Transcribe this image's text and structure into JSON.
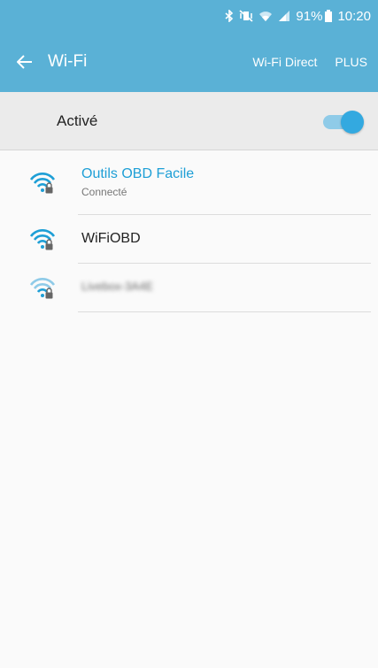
{
  "status_bar": {
    "battery": "91%",
    "time": "10:20",
    "icons": [
      "bluetooth-icon",
      "mute-vibrate-icon",
      "wifi-signal-icon",
      "cell-signal-icon",
      "battery-icon"
    ]
  },
  "header": {
    "title": "Wi-Fi",
    "back_icon": "arrow-left-icon",
    "actions": {
      "wifi_direct": "Wi-Fi Direct",
      "more": "PLUS"
    }
  },
  "toggle": {
    "label": "Activé",
    "on": true
  },
  "networks": [
    {
      "name": "Outils OBD Facile",
      "status": "Connecté",
      "connected": true,
      "secured": true,
      "icon": "wifi-lock-icon"
    },
    {
      "name": "WiFiOBD",
      "status": "",
      "connected": false,
      "secured": true,
      "icon": "wifi-lock-icon"
    },
    {
      "name": "Livebox-3A4E",
      "status": "",
      "connected": false,
      "secured": true,
      "blurred": true,
      "icon": "wifi-lock-icon"
    }
  ],
  "colors": {
    "accent": "#5ab1d6",
    "connected_text": "#1e9fd6",
    "switch_thumb": "#33a9e0",
    "background": "#fafafa"
  }
}
